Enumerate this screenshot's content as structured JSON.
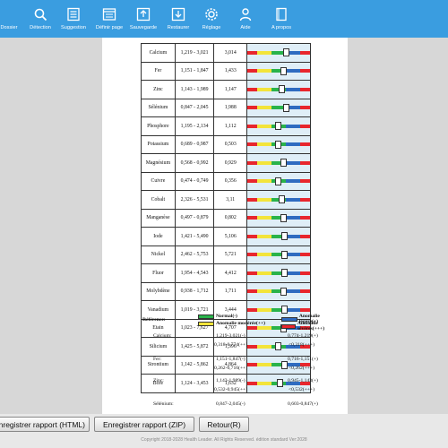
{
  "toolbar": {
    "items": [
      {
        "label": "Dossier",
        "icon": "folder-icon"
      },
      {
        "label": "Détection",
        "icon": "magnifier-icon"
      },
      {
        "label": "Suggestion",
        "icon": "list-icon"
      },
      {
        "label": "Définir page",
        "icon": "page-setup-icon"
      },
      {
        "label": "Sauvegarde",
        "icon": "upload-icon"
      },
      {
        "label": "Restaurer",
        "icon": "download-icon"
      },
      {
        "label": "Réglage",
        "icon": "gear-icon"
      },
      {
        "label": "Aide",
        "icon": "person-icon"
      },
      {
        "label": "A propos",
        "icon": "book-icon"
      }
    ]
  },
  "table": {
    "rows": [
      {
        "name": "Calcium",
        "range": "1,219 - 3,021",
        "value": "3,014",
        "level": 0.62
      },
      {
        "name": "Fer",
        "range": "1,151 - 1,847",
        "value": "1,433",
        "level": 0.58
      },
      {
        "name": "Zinc",
        "range": "1,143 - 1,989",
        "value": "1,147",
        "level": 0.55
      },
      {
        "name": "Sélénium",
        "range": "0,847 - 2,045",
        "value": "1,988",
        "level": 0.62
      },
      {
        "name": "Phosphore",
        "range": "1,195 - 2,134",
        "value": "1,112",
        "level": 0.5
      },
      {
        "name": "Potassium",
        "range": "0,689 - 0,987",
        "value": "0,503",
        "level": 0.5
      },
      {
        "name": "Magnésium",
        "range": "0,568 - 0,992",
        "value": "0,929",
        "level": 0.58
      },
      {
        "name": "Cuivre",
        "range": "0,474 - 0,749",
        "value": "0,356",
        "level": 0.5
      },
      {
        "name": "Cobalt",
        "range": "2,326 - 5,531",
        "value": "3,11",
        "level": 0.55
      },
      {
        "name": "Manganèse",
        "range": "0,497 - 0,879",
        "value": "0,802",
        "level": 0.58
      },
      {
        "name": "Iode",
        "range": "1,421 - 5,490",
        "value": "5,106",
        "level": 0.6
      },
      {
        "name": "Nickel",
        "range": "2,462 - 5,753",
        "value": "5,721",
        "level": 0.6
      },
      {
        "name": "Fluor",
        "range": "1,954 - 4,543",
        "value": "4,412",
        "level": 0.6
      },
      {
        "name": "Molybdène",
        "range": "0,938 - 1,712",
        "value": "1,711",
        "level": 0.58
      },
      {
        "name": "Vanadium",
        "range": "1,019 - 3,721",
        "value": "3,444",
        "level": 0.6
      },
      {
        "name": "Etain",
        "range": "1,023 - 7,627",
        "value": "4,707",
        "level": 0.58
      },
      {
        "name": "Silicium",
        "range": "1,425 - 5,872",
        "value": "1,396",
        "level": 0.5
      },
      {
        "name": "Strontium",
        "range": "1,142 - 5,862",
        "value": "4,864",
        "level": 0.6
      },
      {
        "name": "Bore",
        "range": "1,124 - 3,453",
        "value": "1,632",
        "level": 0.52
      }
    ],
    "bar_colors": {
      "red": "#e8262d",
      "yellow": "#f3e43a",
      "green": "#29b34a",
      "blue": "#2f6bc0"
    }
  },
  "legend": {
    "title": "Référence:",
    "normal": "Normal(-)",
    "moderate": "Anomalie modérée(++)",
    "light": "Anomalie légère(+)",
    "severe": "Anomalie sévères(+++)"
  },
  "reference": [
    {
      "name": "Calcium:",
      "c1": "1,219-3,021(-)",
      "c2": "0,318-0,774(++)",
      "c3": "0,774-1,219(+)",
      "c4": "<0,318(+++)"
    },
    {
      "name": "Fer:",
      "c1": "1,151-1,847(-)",
      "c2": "0,262-0,716(++)",
      "c3": "0,716-1,151(+)",
      "c4": "<0,262(+++)"
    },
    {
      "name": "Zinc:",
      "c1": "1,143-1,989(-)",
      "c2": "0,532-0,945(++)",
      "c3": "0,945-1,143(+)",
      "c4": "<0,532(+++)"
    },
    {
      "name": "Sélénium:",
      "c1": "0,847-2,045(-)",
      "c2": "",
      "c3": "0,603-0,847(+)",
      "c4": ""
    }
  ],
  "bottom": {
    "btn_html": "Enregistrer rapport (HTML)",
    "btn_zip": "Enregistrer rapport (ZIP)",
    "btn_back": "Retour(R)",
    "copyright": "Copyright 2018-2028 Health Leader. All Rights Reserved.   édition standard Ver:2028"
  }
}
